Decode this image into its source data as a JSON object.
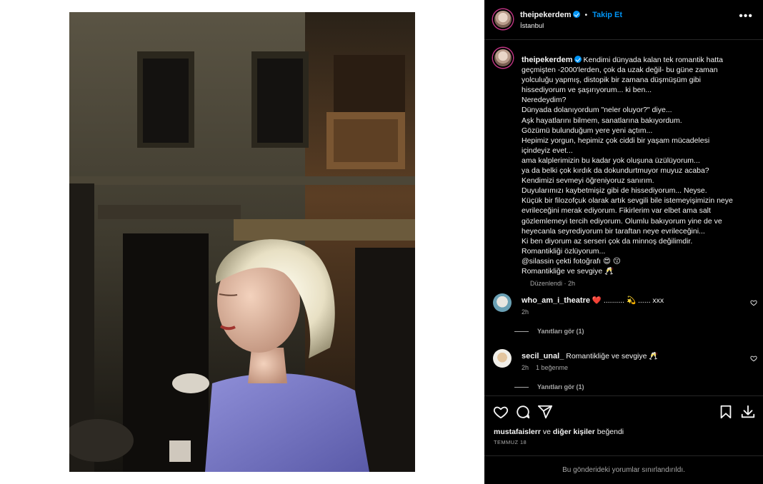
{
  "post": {
    "username": "theipekerdem",
    "follow_label": "Takip Et",
    "location": "İstanbul"
  },
  "caption": {
    "username": "theipekerdem",
    "lines": [
      "Kendimi dünyada kalan tek romantik hatta",
      "geçmişten -2000'lerden, çok da uzak değil- bu güne zaman",
      "yolculuğu yapmış, distopik bir zamana düşmüşüm gibi",
      "hissediyorum ve şaşırıyorum... ki ben...",
      "Neredeydim?",
      "Dünyada dolanıyordum \"neler oluyor?\" diye...",
      "Aşk hayatlarını bilmem, sanatlarına bakıyordum.",
      "Gözümü bulunduğum yere yeni açtım...",
      "Hepimiz yorgun, hepimiz çok ciddi bir yaşam mücadelesi",
      "içindeyiz evet...",
      "ama kalplerimizin bu kadar yok oluşuna üzülüyorum...",
      "ya da belki çok kırdık da dokundurtmuyor muyuz acaba?",
      "Kendimizi sevmeyi öğreniyoruz sanırım.",
      "Duyularımızı kaybetmişiz gibi de hissediyorum... Neyse.",
      "Küçük bir filozofçuk olarak artık sevgili bile istemeyişimizin neye",
      "evrileceğini merak ediyorum. Fikirlerim var elbet ama salt",
      "gözlemlemeyi tercih ediyorum. Olumlu bakıyorum yine de ve",
      "heyecanla seyrediyorum bir taraftan neye evrileceğini...",
      "Ki ben diyorum az serseri çok da minnoş değilimdir.",
      "Romantikliği özlüyorum...",
      "@silassin çekti fotoğrafı 😍 😗",
      "Romantikliğe ve sevgiye 🥂"
    ],
    "edited_label": "Düzenlendi · 2h"
  },
  "comments": [
    {
      "username": "who_am_i_theatre",
      "text": "❤️ .......... 💫 ...... xxx",
      "time": "2h",
      "likes": "",
      "replies_label": "Yanıtları gör (1)"
    },
    {
      "username": "secil_unal_",
      "text": "Romantikliğe ve sevgiye 🥂",
      "time": "2h",
      "likes": "1 beğenme",
      "replies_label": "Yanıtları gör (1)"
    }
  ],
  "actions": {
    "icons": [
      "heart-icon",
      "comment-icon",
      "share-icon",
      "bookmark-icon",
      "download-icon"
    ]
  },
  "likes": {
    "first_user": "mustafaislerr",
    "connector": " ve ",
    "others": "diğer kişiler",
    "suffix": " beğendi"
  },
  "date": "TEMMUZ 18",
  "comments_limited": "Bu gönderideki yorumlar sınırlandırıldı.",
  "colors": {
    "background": "#000000",
    "accent_blue": "#0095f6",
    "muted_text": "#a8a8a8",
    "heart_red": "#e0245e"
  }
}
